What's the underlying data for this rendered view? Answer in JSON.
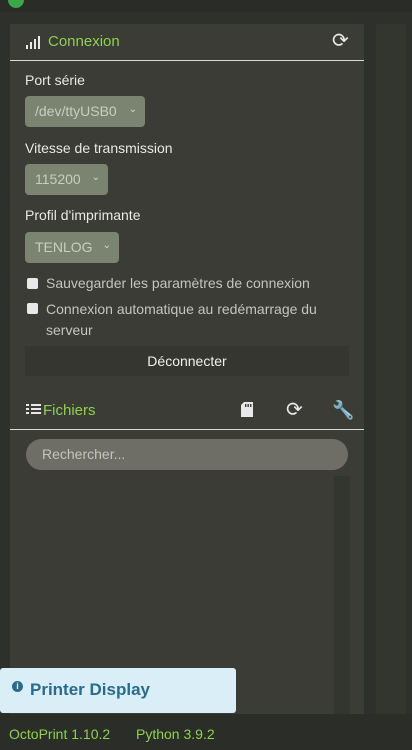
{
  "connection": {
    "title": "Connexion",
    "serial_port_label": "Port série",
    "serial_port_value": "/dev/ttyUSB0",
    "baudrate_label": "Vitesse de transmission",
    "baudrate_value": "115200",
    "profile_label": "Profil d'imprimante",
    "profile_value": "TENLOG",
    "save_settings_label": "Sauvegarder les paramètres de connexion",
    "auto_connect_label_line1": "Connexion automatique au redémarrage du",
    "auto_connect_label_line2": "serveur",
    "disconnect_label": "Déconnecter"
  },
  "files": {
    "title": "Fichiers",
    "search_placeholder": "Rechercher..."
  },
  "printer_display": {
    "label": "Printer Display"
  },
  "footer": {
    "octoprint_version": "OctoPrint 1.10.2",
    "python_version": "Python 3.9.2"
  }
}
